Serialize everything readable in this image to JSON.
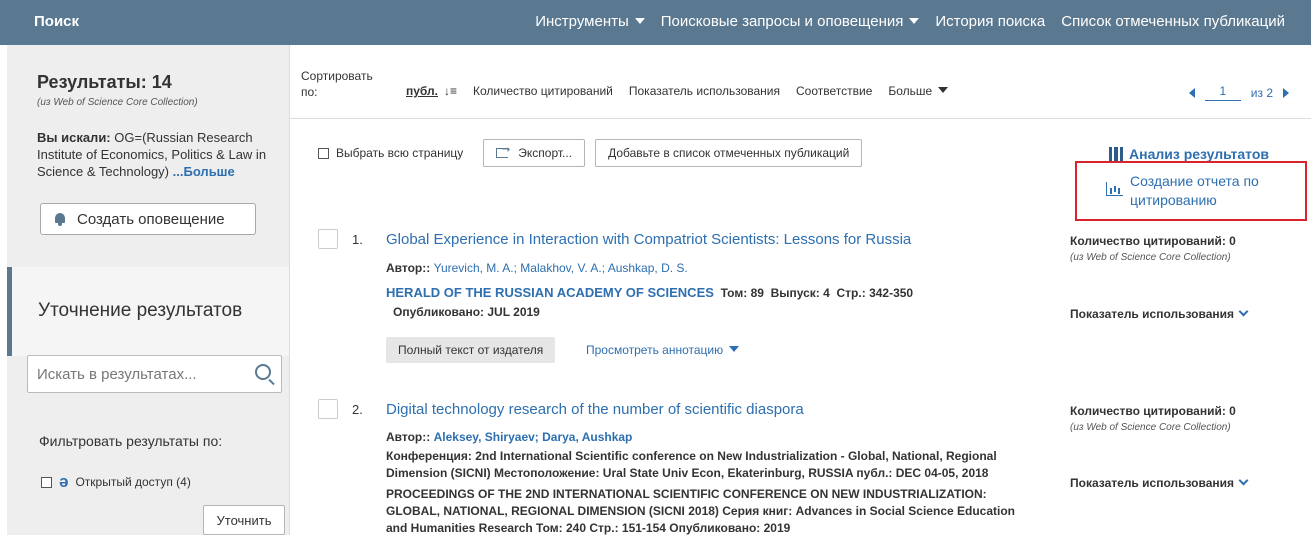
{
  "topbar": {
    "brand": "Поиск",
    "nav": [
      {
        "label": "Инструменты",
        "dropdown": true
      },
      {
        "label": "Поисковые запросы и оповещения",
        "dropdown": true
      },
      {
        "label": "История поиска",
        "dropdown": false
      },
      {
        "label": "Список отмеченных публикаций",
        "dropdown": false
      }
    ],
    "bg_color": "#5a7890"
  },
  "sidebar": {
    "results_title": "Результаты: 14",
    "results_source": "(из Web of Science Core Collection)",
    "query_label": "Вы искали:",
    "query_text": "OG=(Russian Research Institute of Economics, Politics & Law in Science & Technology)",
    "query_more": "...Больше",
    "create_alert": "Создать оповещение",
    "refine_heading": "Уточнение результатов",
    "search_placeholder": "Искать в результатах...",
    "filter_title": "Фильтровать результаты по:",
    "open_access": "Открытый доступ (4)",
    "refine_button": "Уточнить"
  },
  "sortbar": {
    "label": "Сортировать по:",
    "options": [
      "публ.",
      "Количество цитирований",
      "Показатель использования",
      "Соответствие",
      "Больше"
    ],
    "active_index": 0,
    "page_current": "1",
    "page_of": "из 2"
  },
  "actions": {
    "select_all": "Выбрать всю страницу",
    "export": "Экспорт...",
    "add_marked": "Добавьте в список отмеченных публикаций",
    "analyze": "Анализ результатов",
    "citation_report": "Создание отчета по цитированию",
    "highlight_color": "#d9232d"
  },
  "records": [
    {
      "num": "1.",
      "title": "Global Experience in Interaction with Compatriot Scientists: Lessons for Russia",
      "author_label": "Автор::",
      "authors": "Yurevich, M. A.; Malakhov, V. A.; Aushkap, D. S.",
      "journal": "HERALD OF THE RUSSIAN ACADEMY OF SCIENCES",
      "volume_label": "Том:",
      "volume": "89",
      "issue_label": "Выпуск:",
      "issue": "4",
      "pages_label": "Стр.:",
      "pages": "342-350",
      "published_label": "Опубликовано:",
      "published": "JUL 2019",
      "fulltext": "Полный текст от издателя",
      "abstract": "Просмотреть аннотацию",
      "citations": "Количество цитирований: 0",
      "cite_source": "(из Web of Science Core Collection)",
      "usage": "Показатель использования"
    },
    {
      "num": "2.",
      "title": "Digital technology research of the number of scientific diaspora",
      "author_label": "Автор::",
      "authors": "Aleksey, Shiryaev; Darya, Aushkap",
      "conference_line1": "Конференция: 2nd International Scientific conference on New Industrialization - Global, National, Regional",
      "conference_line2": "Dimension (SICNI) Местоположение: Ural State Univ Econ, Ekaterinburg, RUSSIA публ.: DEC 04-05, 2018",
      "proceedings_line1": "PROCEEDINGS OF THE 2ND INTERNATIONAL SCIENTIFIC CONFERENCE ON NEW INDUSTRIALIZATION:",
      "proceedings_line2": "GLOBAL, NATIONAL, REGIONAL DIMENSION (SICNI 2018) Серия книг: Advances in Social Science Education",
      "proceedings_line3": "and Humanities Research Том: 240 Стр.: 151-154 Опубликовано: 2019",
      "citations": "Количество цитирований: 0",
      "cite_source": "(из Web of Science Core Collection)",
      "usage": "Показатель использования"
    }
  ]
}
